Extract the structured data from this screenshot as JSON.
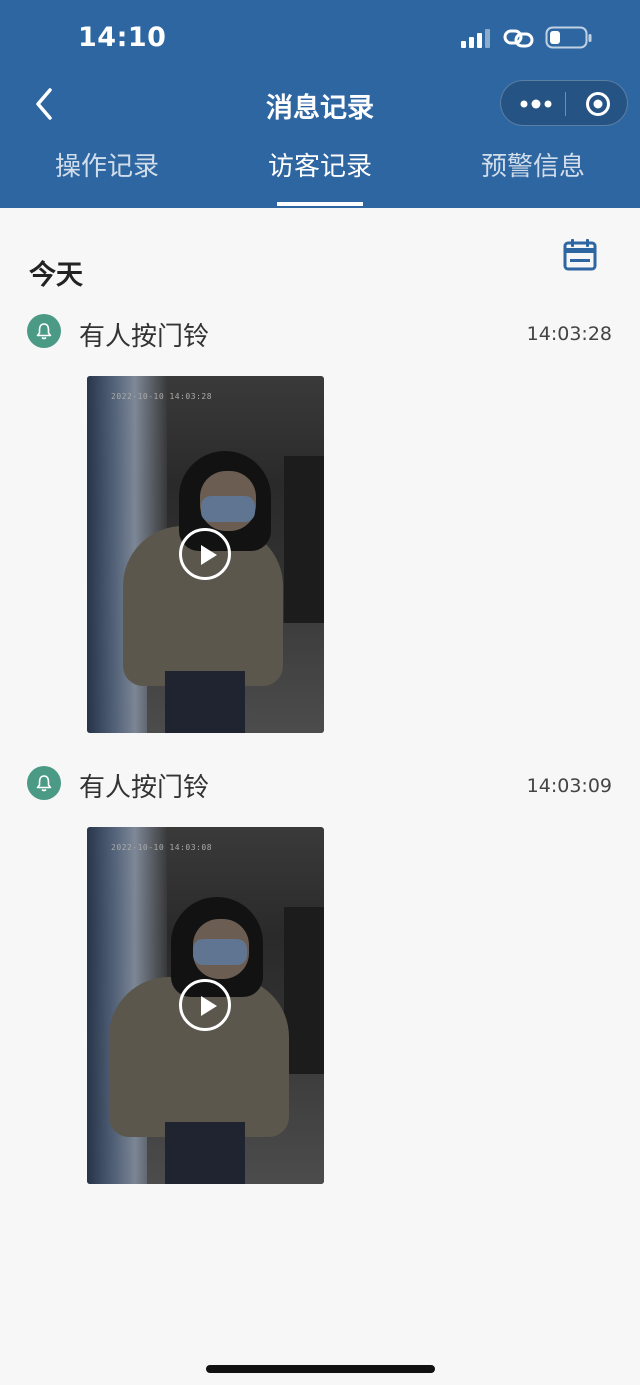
{
  "status": {
    "time": "14:10"
  },
  "nav": {
    "title": "消息记录"
  },
  "tabs": [
    {
      "label": "操作记录",
      "active": false
    },
    {
      "label": "访客记录",
      "active": true
    },
    {
      "label": "预警信息",
      "active": false
    }
  ],
  "section": {
    "title": "今天"
  },
  "events": [
    {
      "title": "有人按门铃",
      "time": "14:03:28",
      "video_timestamp": "2022-10-10 14:03:28"
    },
    {
      "title": "有人按门铃",
      "time": "14:03:09",
      "video_timestamp": "2022-10-10 14:03:08"
    }
  ],
  "colors": {
    "header": "#2d66a1",
    "accent_icon": "#4a9a86",
    "calendar": "#2d66a1"
  }
}
